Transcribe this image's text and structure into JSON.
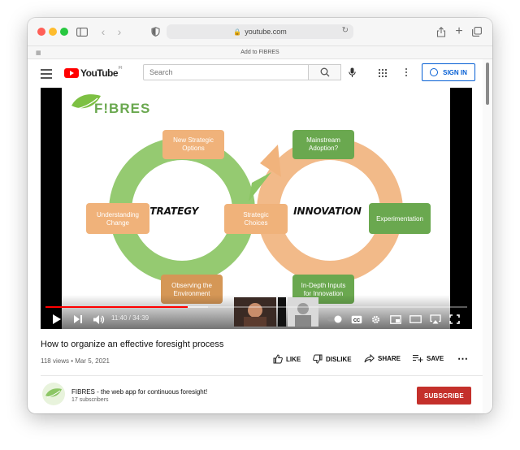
{
  "browser": {
    "url": "youtube.com",
    "favorites_bar_item": "Add to FIBRES"
  },
  "header": {
    "logo_text": "YouTube",
    "region_code": "FI",
    "search_placeholder": "Search",
    "sign_in_label": "SIGN IN"
  },
  "video": {
    "slide": {
      "brand": "F!BRES",
      "left_loop_label": "STRATEGY",
      "right_loop_label": "INNOVATION",
      "boxes": {
        "new_strategic_options": [
          "New Strategic",
          "Options"
        ],
        "understanding_change": [
          "Understanding",
          "Change"
        ],
        "strategic_choices": [
          "Strategic",
          "Choices"
        ],
        "observing_environment": [
          "Observing the",
          "Environment"
        ],
        "mainstream_adoption": [
          "Mainstream",
          "Adoption?"
        ],
        "experimentation": [
          "Experimentation"
        ],
        "in_depth_inputs": [
          "In-Depth Inputs",
          "for Innovation"
        ]
      }
    },
    "time_current": "11:40",
    "time_total": "34:39",
    "timecode": "11:40 / 34:39",
    "progress_fraction": 0.337,
    "buffer_fraction": 0.385,
    "cc_label": "CC"
  },
  "info": {
    "title": "How to organize an effective foresight process",
    "meta": "118 views • Mar 5, 2021",
    "like_label": "LIKE",
    "dislike_label": "DISLIKE",
    "share_label": "SHARE",
    "save_label": "SAVE"
  },
  "channel": {
    "name": "FIBRES - the web app for continuous foresight!",
    "subscribers": "17 subscribers",
    "subscribe_label": "SUBSCRIBE"
  },
  "colors": {
    "accent_red": "#ff0000",
    "subscribe_red": "#c4302b",
    "link_blue": "#065fd4",
    "green_box": "#6aa84f",
    "orange_box": "#f0b27a"
  }
}
